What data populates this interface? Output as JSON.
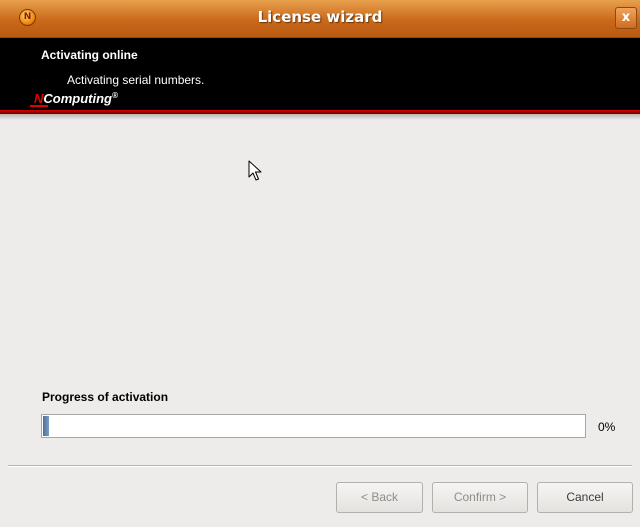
{
  "window": {
    "title": "License wizard",
    "close_label": "x",
    "app_icon": "N"
  },
  "header": {
    "title": "Activating online",
    "subtitle": "Activating serial numbers.",
    "logo": {
      "prefix": "N",
      "name": "Computing",
      "mark": "®"
    }
  },
  "progress": {
    "label": "Progress of activation",
    "value_text": "0%",
    "value": 0
  },
  "buttons": {
    "back": "< Back",
    "confirm": "Confirm >",
    "cancel": "Cancel"
  },
  "colors": {
    "titlebar": "#c9691b",
    "header_bg": "#000000",
    "accent_red": "#d80000",
    "progress_fill": "#5a7eb0"
  }
}
